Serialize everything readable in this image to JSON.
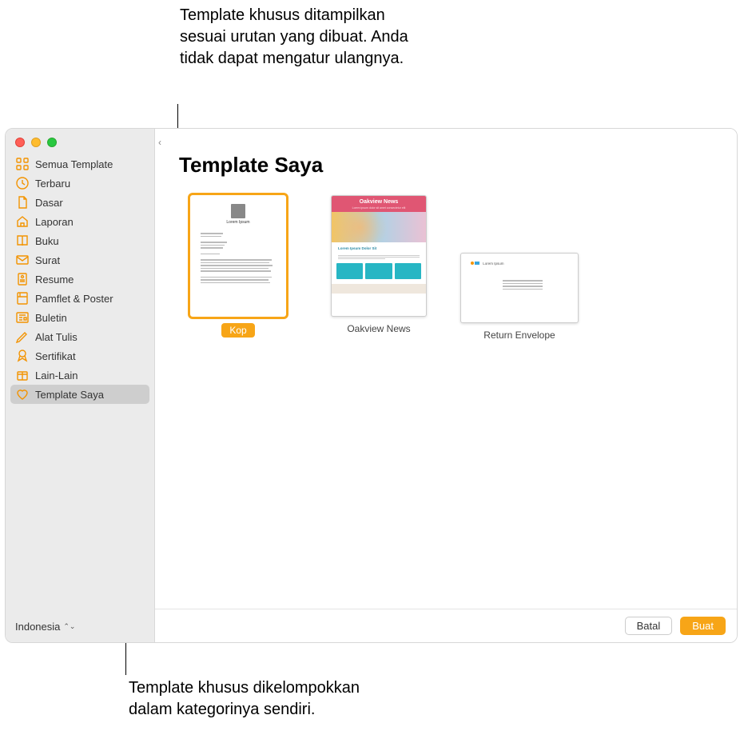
{
  "annotations": {
    "top": "Template khusus ditampilkan sesuai urutan yang dibuat. Anda tidak dapat mengatur ulangnya.",
    "bottom": "Template khusus dikelompokkan dalam kategorinya sendiri."
  },
  "sidebar": {
    "categories": [
      {
        "id": "all",
        "label": "Semua Template",
        "icon": "grid"
      },
      {
        "id": "recent",
        "label": "Terbaru",
        "icon": "clock"
      },
      {
        "id": "basic",
        "label": "Dasar",
        "icon": "doc"
      },
      {
        "id": "reports",
        "label": "Laporan",
        "icon": "home"
      },
      {
        "id": "books",
        "label": "Buku",
        "icon": "book"
      },
      {
        "id": "letters",
        "label": "Surat",
        "icon": "mail"
      },
      {
        "id": "resume",
        "label": "Resume",
        "icon": "person-doc"
      },
      {
        "id": "flyers",
        "label": "Pamflet & Poster",
        "icon": "poster"
      },
      {
        "id": "newsletter",
        "label": "Buletin",
        "icon": "newspaper"
      },
      {
        "id": "stationery",
        "label": "Alat Tulis",
        "icon": "pencil"
      },
      {
        "id": "certs",
        "label": "Sertifikat",
        "icon": "ribbon"
      },
      {
        "id": "other",
        "label": "Lain-Lain",
        "icon": "box"
      },
      {
        "id": "mine",
        "label": "Template Saya",
        "icon": "heart",
        "selected": true
      }
    ],
    "language": "Indonesia"
  },
  "main": {
    "title": "Template Saya",
    "templates": [
      {
        "label": "Kop",
        "selected": true,
        "kind": "letter"
      },
      {
        "label": "Oakview News",
        "selected": false,
        "kind": "newsletter",
        "headline": "Oakview News",
        "story": "Lorem Ipsum Dolor Sit"
      },
      {
        "label": "Return Envelope",
        "selected": false,
        "kind": "envelope"
      }
    ]
  },
  "footer": {
    "cancel": "Batal",
    "create": "Buat"
  }
}
